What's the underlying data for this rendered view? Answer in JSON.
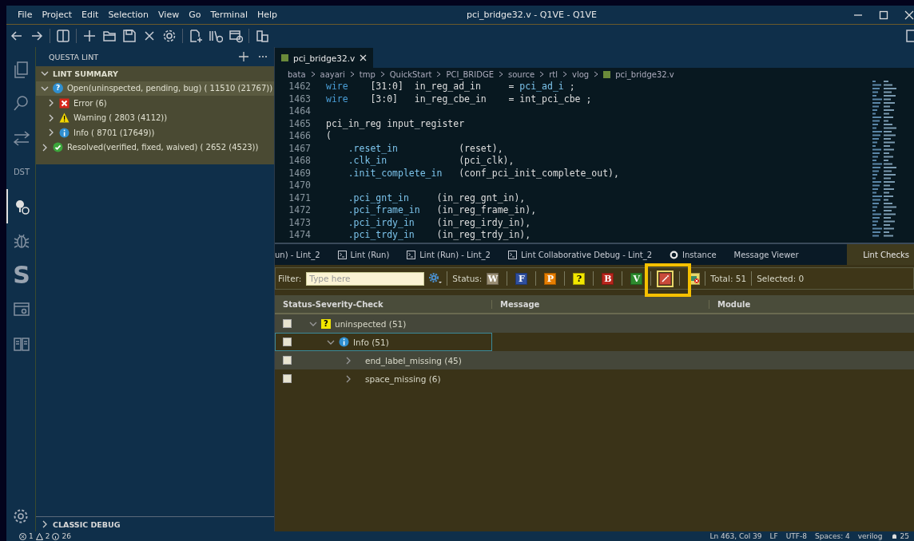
{
  "window": {
    "title": "pci_bridge32.v - Q1VE - Q1VE"
  },
  "menu": [
    "File",
    "Project",
    "Edit",
    "Selection",
    "View",
    "Go",
    "Terminal",
    "Help"
  ],
  "activity": [
    {
      "kind": "files",
      "selected": false
    },
    {
      "kind": "search",
      "selected": false
    },
    {
      "kind": "swap",
      "selected": false
    },
    {
      "kind": "text",
      "text": "DST",
      "selected": false
    },
    {
      "kind": "lint",
      "selected": true
    },
    {
      "kind": "bug",
      "selected": false
    },
    {
      "kind": "bigtext",
      "text": "S",
      "selected": false
    },
    {
      "kind": "panel",
      "selected": false
    },
    {
      "kind": "book",
      "selected": false
    }
  ],
  "sidebar": {
    "title": "QUESTA LINT",
    "section": {
      "label": "LINT SUMMARY",
      "expanded": true
    },
    "tree": [
      {
        "label": "Open(uninspected, pending, bug) ( 11510 (21767))",
        "kind": "open",
        "icon": "?",
        "expanded": true,
        "children": [
          {
            "label": "Error (6)",
            "kind": "error",
            "expanded": false
          },
          {
            "label": "Warning ( 2803 (4112))",
            "kind": "warning",
            "expanded": false
          },
          {
            "label": "Info ( 8701 (17649))",
            "kind": "info",
            "expanded": false
          }
        ]
      },
      {
        "label": "Resolved(verified, fixed, waived) ( 2652 (4523))",
        "kind": "resolved",
        "expanded": false
      }
    ],
    "footer": {
      "label": "CLASSIC DEBUG",
      "expanded": false
    }
  },
  "editor": {
    "tab": "pci_bridge32.v",
    "breadcrumb": [
      "bata",
      "aayari",
      "tmp",
      "QuickStart",
      "PCI_BRIDGE",
      "source",
      "rtl",
      "vlog",
      "pci_bridge32.v"
    ],
    "lines": [
      {
        "number": "1462",
        "parts": [
          {
            "kind": "kw",
            "text": "wire"
          },
          {
            "kind": "text",
            "text": "    [31:0]  in_reg_ad_in     = "
          },
          {
            "kind": "port",
            "text": "pci_ad_i"
          },
          {
            "kind": "text",
            "text": " ;"
          }
        ]
      },
      {
        "number": "1463",
        "parts": [
          {
            "kind": "kw",
            "text": "wire"
          },
          {
            "kind": "text",
            "text": "    [3:0]   in_reg_cbe_in    = int_pci_cbe ;"
          }
        ]
      },
      {
        "number": "1464"
      },
      {
        "number": "1465",
        "parts": [
          {
            "kind": "text",
            "text": "pci_in_reg input_register"
          }
        ]
      },
      {
        "number": "1466",
        "parts": [
          {
            "kind": "text",
            "text": "("
          }
        ]
      },
      {
        "number": "1467",
        "parts": [
          {
            "kind": "port",
            "text": "    .reset_in"
          },
          {
            "kind": "text",
            "text": "           (reset),"
          }
        ]
      },
      {
        "number": "1468",
        "parts": [
          {
            "kind": "port",
            "text": "    .clk_in"
          },
          {
            "kind": "text",
            "text": "             (pci_clk),"
          }
        ]
      },
      {
        "number": "1469",
        "parts": [
          {
            "kind": "port",
            "text": "    .init_complete_in"
          },
          {
            "kind": "text",
            "text": "   (conf_pci_init_complete_out),"
          }
        ]
      },
      {
        "number": "1470"
      },
      {
        "number": "1471",
        "parts": [
          {
            "kind": "port",
            "text": "    .pci_gnt_in"
          },
          {
            "kind": "text",
            "text": "     (in_reg_gnt_in),"
          }
        ]
      },
      {
        "number": "1472",
        "parts": [
          {
            "kind": "port",
            "text": "    .pci_frame_in"
          },
          {
            "kind": "text",
            "text": "   (in_reg_frame_in),"
          }
        ]
      },
      {
        "number": "1473",
        "parts": [
          {
            "kind": "port",
            "text": "    .pci_irdy_in"
          },
          {
            "kind": "text",
            "text": "    (in_reg_irdy_in),"
          }
        ]
      },
      {
        "number": "1474",
        "parts": [
          {
            "kind": "port",
            "text": "    .pci_trdy_in"
          },
          {
            "kind": "text",
            "text": "    (in_reg_trdy_in),"
          }
        ]
      }
    ]
  },
  "panel": {
    "tabs": [
      {
        "label": "un) - Lint_2",
        "kind": "plain",
        "selected": false
      },
      {
        "label": "Lint (Run)",
        "kind": "terminal",
        "selected": false
      },
      {
        "label": "Lint (Run) - Lint_2",
        "kind": "terminal",
        "selected": false
      },
      {
        "label": "Lint Collaborative Debug - Lint_2",
        "kind": "terminal",
        "selected": false
      },
      {
        "label": "Instance",
        "kind": "circle",
        "selected": false
      },
      {
        "label": "Message Viewer",
        "kind": "plain",
        "selected": false
      },
      {
        "label": "Lint Checks",
        "kind": "plain",
        "selected": true
      }
    ],
    "filter": {
      "label": "Filter:",
      "placeholder": "Type here"
    },
    "status_label": "Status:",
    "status_buttons": [
      {
        "kind": "letter",
        "text": "W",
        "color": "#9a8e74",
        "highlighted": false
      },
      {
        "kind": "letter",
        "text": "F",
        "color": "#2f4f9e",
        "highlighted": false
      },
      {
        "kind": "letter",
        "text": "P",
        "color": "#e67e00",
        "highlighted": false
      },
      {
        "kind": "letter",
        "text": "?",
        "color": "#f2e600",
        "highlighted": false
      },
      {
        "kind": "letter",
        "text": "B",
        "color": "#b8261c",
        "highlighted": false
      },
      {
        "kind": "letter",
        "text": "V",
        "color": "#2e8b2e",
        "highlighted": false
      },
      {
        "kind": "wand",
        "color": "#c94a3a",
        "highlighted": true
      },
      {
        "kind": "bot",
        "color": "#e8d66a",
        "highlighted": false
      }
    ],
    "total": "Total: 51",
    "selected_count": "Selected: 0",
    "table": {
      "columns": [
        "Status-Severity-Check",
        "Message",
        "Module"
      ],
      "rows": [
        {
          "label": "uninspected (51)",
          "kind": "status",
          "icon": "?",
          "checked": false,
          "expanded": true,
          "selected": false,
          "children": [
            {
              "label": "Info (51)",
              "kind": "info",
              "checked": false,
              "expanded": true,
              "selected": true,
              "children": [
                {
                  "label": "end_label_missing (45)",
                  "kind": "check",
                  "checked": false,
                  "expanded": false,
                  "selected": false
                },
                {
                  "label": "space_missing (6)",
                  "kind": "check",
                  "checked": false,
                  "expanded": false,
                  "selected": false
                }
              ]
            }
          ]
        }
      ]
    }
  },
  "status_bar": {
    "errors": "1",
    "warnings": "2",
    "infos": "26",
    "items": [
      "Ln 463, Col 39",
      "LF",
      "UTF-8",
      "Spaces: 4",
      "verilog"
    ],
    "notifications": "25"
  }
}
